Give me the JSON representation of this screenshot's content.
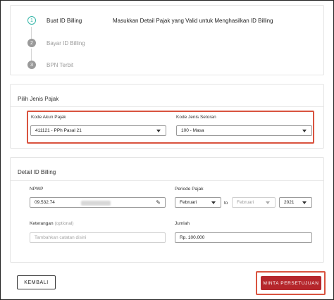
{
  "steps": {
    "items": [
      {
        "number": "1",
        "label": "Buat ID Billing"
      },
      {
        "number": "2",
        "label": "Bayar ID Billing"
      },
      {
        "number": "3",
        "label": "BPN Terbit"
      }
    ],
    "heading": "Masukkan Detail Pajak yang Valid untuk Menghasilkan ID Billing"
  },
  "pilih_jenis_pajak": {
    "title": "Pilih Jenis Pajak",
    "kode_akun_label": "Kode Akun Pajak",
    "kode_akun_value": "411121 - PPh Pasal 21",
    "kode_setoran_label": "Kode Jenis Setoran",
    "kode_setoran_value": "100 - Masa"
  },
  "detail_billing": {
    "title": "Detail ID Billing",
    "npwp_label": "NPWP",
    "npwp_value": "09.532.74",
    "periode_label": "Periode Pajak",
    "periode_from": "Februari",
    "periode_to_word": "to",
    "periode_to": "Februari",
    "periode_year": "2021",
    "keterangan_label": "Keterangan",
    "keterangan_optional": "(optional)",
    "keterangan_placeholder": "Tambahkan catatan disini",
    "jumlah_label": "Jumlah",
    "jumlah_value": "Rp. 100.000"
  },
  "buttons": {
    "kembali": "KEMBALI",
    "minta": "MINTA PERSETUJUAN"
  },
  "colors": {
    "accent": "#b5262b",
    "highlight": "#d9533f",
    "step_active": "#35b6a8"
  }
}
